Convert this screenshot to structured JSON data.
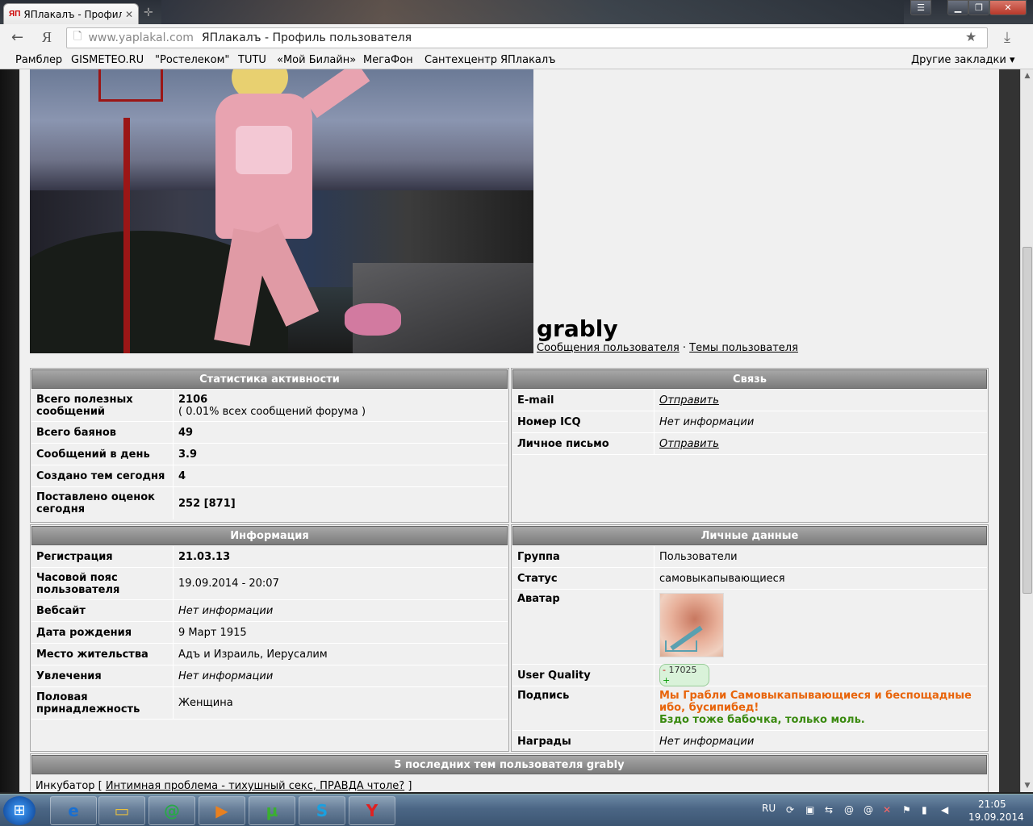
{
  "browser": {
    "tab_title": "ЯПлакалъ - Профиль",
    "tab_favicon": "ЯП",
    "url_domain": "www.yaplakal.com",
    "page_title": "ЯПлакалъ - Профиль пользователя",
    "bookmarks": [
      "Рамблер",
      "GISMETEO.RU",
      "\"Ростелеком\"",
      "TUTU",
      "«Мой Билайн»",
      "МегаФон",
      "Сантехцентр",
      "ЯПлакалъ"
    ],
    "other_bookmarks": "Другие закладки ▾"
  },
  "profile": {
    "username": "grably",
    "link_messages": "Сообщения пользователя",
    "link_sep": " · ",
    "link_topics": "Темы пользователя"
  },
  "stats": {
    "title": "Статистика активности",
    "rows": [
      {
        "k": "Всего полезных сообщений",
        "v": "2106",
        "sub": "( 0.01% всех сообщений форума )"
      },
      {
        "k": "Всего баянов",
        "v": "49"
      },
      {
        "k": "Сообщений в день",
        "v": "3.9"
      },
      {
        "k": "Создано тем сегодня",
        "v": "4"
      },
      {
        "k": "Поставлено оценок сегодня",
        "v": "252 [871]"
      }
    ]
  },
  "contact": {
    "title": "Связь",
    "rows": [
      {
        "k": "E-mail",
        "v": "Отправить"
      },
      {
        "k": "Номер ICQ",
        "v": "Нет информации"
      },
      {
        "k": "Личное письмо",
        "v": "Отправить"
      }
    ]
  },
  "info": {
    "title": "Информация",
    "rows": [
      {
        "k": "Регистрация",
        "v": "21.03.13"
      },
      {
        "k": "Часовой пояс пользователя",
        "v": "19.09.2014 - 20:07"
      },
      {
        "k": "Вебсайт",
        "v": "Нет информации"
      },
      {
        "k": "Дата рождения",
        "v": "9 Март 1915"
      },
      {
        "k": "Место жительства",
        "v": "Адъ и Израиль, Иерусалим"
      },
      {
        "k": "Увлечения",
        "v": "Нет информации"
      },
      {
        "k": "Половая принадлежность",
        "v": "Женщина"
      }
    ]
  },
  "personal": {
    "title": "Личные данные",
    "group_k": "Группа",
    "group_v": "Пользователи",
    "status_k": "Статус",
    "status_v": "самовыкапывающиеся",
    "avatar_k": "Аватар",
    "uq_k": "User Quality",
    "uq_minus": "-",
    "uq_v": "17025",
    "uq_plus": "+",
    "sig_k": "Подпись",
    "sig_line1": "Мы Грабли Самовыкапывающиеся и беспощадные ибо, бусипибед!",
    "sig_line2": "Бздо тоже бабочка, только моль.",
    "awards_k": "Награды",
    "awards_v": "Нет информации"
  },
  "last_topics": {
    "title": "5 последних тем пользователя grably",
    "first_forum": "Инкубатор",
    "first_bracket_open": " [ ",
    "first_topic": "Интимная проблема - тихушный секс, ПРАВДА чтоле?",
    "first_bracket_close": " ]"
  },
  "tray": {
    "lang": "RU",
    "time": "21:05",
    "date": "19.09.2014"
  },
  "colors": {
    "header_bg": "#8c8c8c",
    "sig_orange": "#e8640a",
    "sig_green": "#3a8a10"
  }
}
